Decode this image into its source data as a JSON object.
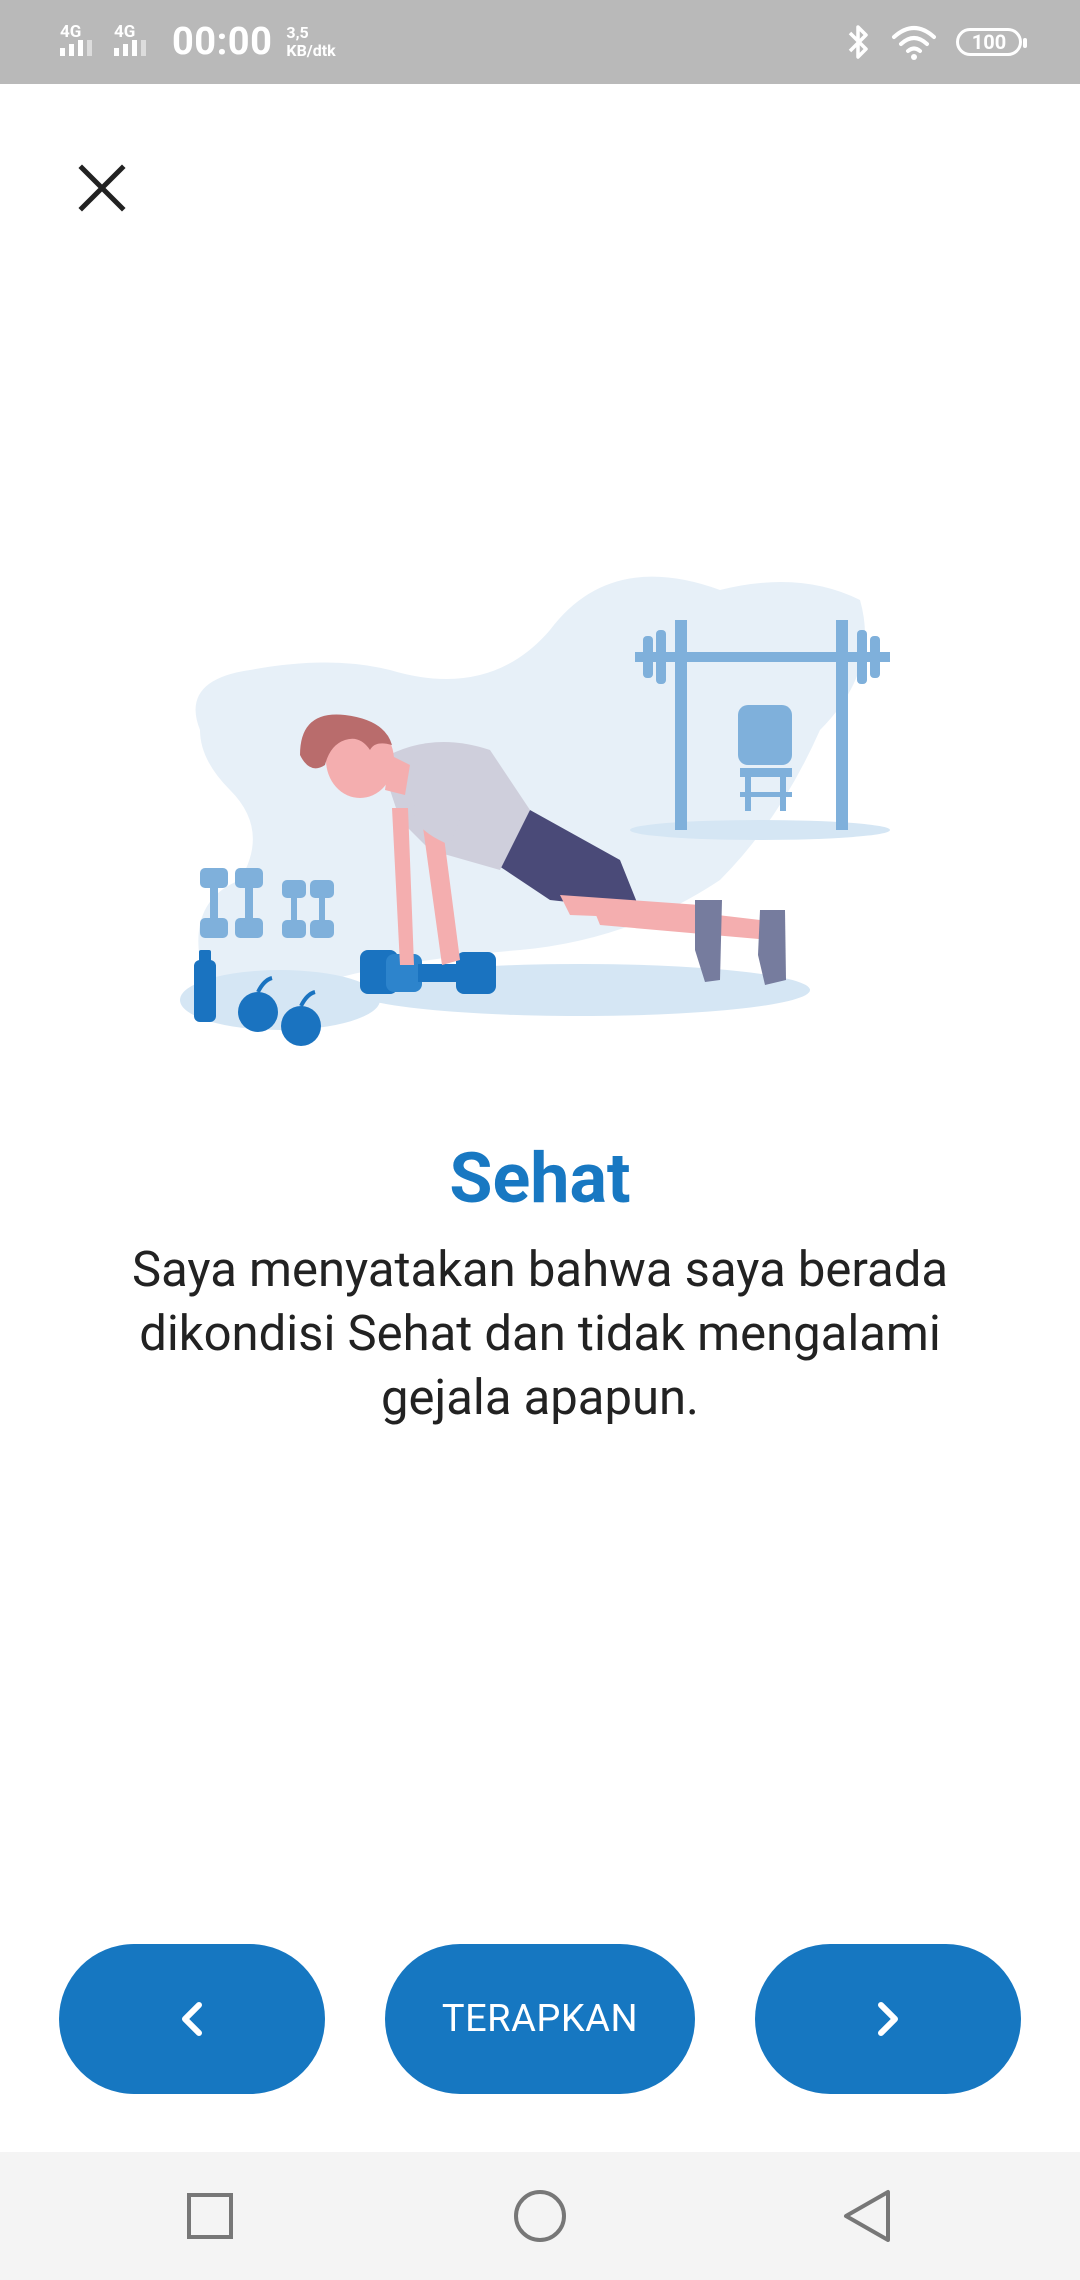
{
  "status_bar": {
    "network_1": "4G",
    "network_2": "4G",
    "time": "00:00",
    "speed_value": "3,5",
    "speed_unit": "KB/dtk",
    "battery": "100"
  },
  "content": {
    "title": "Sehat",
    "description": "Saya menyatakan bahwa saya berada dikondisi Sehat dan tidak mengalami gejala apapun."
  },
  "buttons": {
    "apply_label": "TERAPKAN"
  },
  "colors": {
    "accent": "#1677c1",
    "title": "#1878c2",
    "status_bar": "#b9b9b9",
    "nav_bar": "#f4f4f4"
  },
  "icons": {
    "close": "close-icon",
    "prev": "chevron-left-icon",
    "next": "chevron-right-icon",
    "nav_recent": "square-icon",
    "nav_home": "circle-icon",
    "nav_back": "triangle-back-icon"
  }
}
